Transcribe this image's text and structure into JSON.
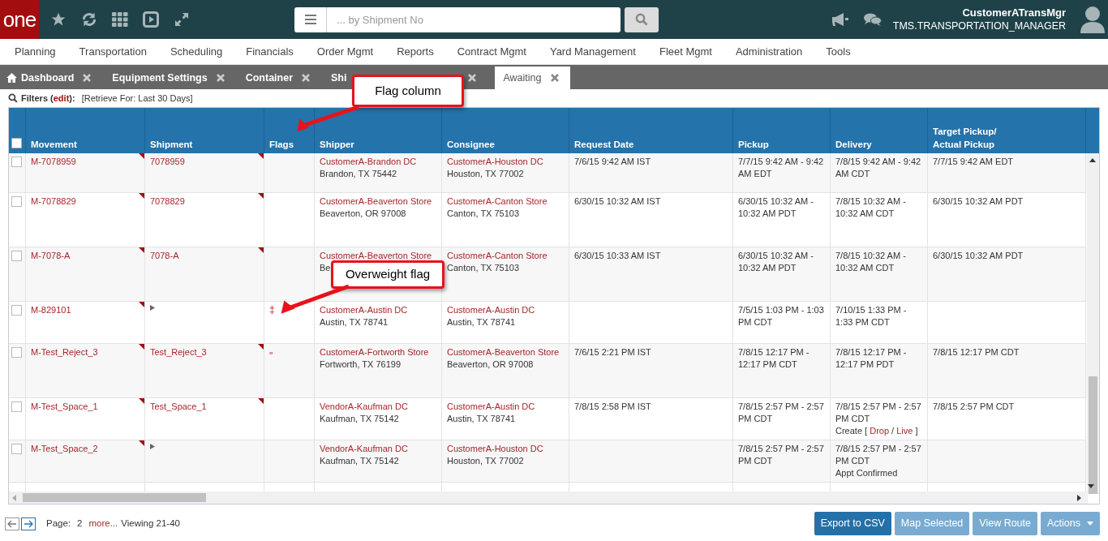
{
  "header": {
    "logo": "one",
    "search": {
      "placeholder": "... by Shipment No"
    },
    "user": {
      "name": "CustomerATransMgr",
      "role": "TMS.TRANSPORTATION_MANAGER"
    }
  },
  "nav": [
    "Planning",
    "Transportation",
    "Scheduling",
    "Financials",
    "Order Mgmt",
    "Reports",
    "Contract Mgmt",
    "Yard Management",
    "Fleet Mgmt",
    "Administration",
    "Tools"
  ],
  "tabs": [
    {
      "label": "Dashboard",
      "home": true,
      "selected": false
    },
    {
      "label": "Equipment Settings",
      "home": false,
      "selected": false
    },
    {
      "label": "Container",
      "home": false,
      "selected": false
    },
    {
      "label": "Shi",
      "home": false,
      "selected": false
    },
    {
      "label": "Awaiting",
      "home": false,
      "selected": true
    }
  ],
  "filters": {
    "label": "Filters (",
    "edit": "edit",
    "suffix": "):",
    "value": "[Retrieve For: Last 30 Days]"
  },
  "table": {
    "select_all_checked": false,
    "columns": [
      "Movement",
      "Shipment",
      "Flags",
      "Shipper",
      "Consignee",
      "Request Date",
      "Pickup",
      "Delivery",
      "Target Pickup/\nActual Pickup"
    ],
    "rows": [
      {
        "checked": false,
        "movement": "M-7078959",
        "shipment": "7078959",
        "flag": null,
        "shipper": "CustomerA-Brandon DC",
        "shipper_address": "Brandon, TX 75442",
        "consignee": "CustomerA-Houston DC",
        "consignee_address": "Houston, TX 77002",
        "request_date": "7/6/15 9:42 AM IST",
        "pickup": "7/7/15 9:42 AM - 9:42 AM EDT",
        "delivery": "7/8/15 9:42 AM - 9:42 AM CDT",
        "target_pickup": "7/7/15 9:42 AM EDT"
      },
      {
        "checked": false,
        "movement": "M-7078829",
        "shipment": "7078829",
        "flag": null,
        "shipper": "CustomerA-Beaverton Store",
        "shipper_address": "Beaverton, OR 97008",
        "consignee": "CustomerA-Canton Store",
        "consignee_address": "Canton, TX 75103",
        "request_date": "6/30/15 10:32 AM IST",
        "pickup": "6/30/15 10:32 AM - 10:32 AM PDT",
        "delivery": "7/8/15 10:32 AM - 10:32 AM CDT",
        "target_pickup": "6/30/15 10:32 AM PDT"
      },
      {
        "checked": false,
        "movement": "M-7078-A",
        "shipment": "7078-A",
        "flag": null,
        "shipper": "CustomerA-Beaverton Store",
        "shipper_address": "Be",
        "consignee": "CustomerA-Canton Store",
        "consignee_address": "Canton, TX 75103",
        "request_date": "6/30/15 10:33 AM IST",
        "pickup": "6/30/15 10:32 AM - 10:32 AM PDT",
        "delivery": "7/8/15 10:32 AM - 10:32 AM CDT",
        "target_pickup": "6/30/15 10:32 AM PDT"
      },
      {
        "checked": false,
        "movement": "M-829101",
        "shipment": null,
        "flag": "‡",
        "shipper": "CustomerA-Austin DC",
        "shipper_address": "Austin, TX 78741",
        "consignee": "CustomerA-Austin DC",
        "consignee_address": "Austin, TX 78741",
        "request_date": null,
        "pickup": "7/5/15 1:03 PM - 1:03 PM CDT",
        "delivery": "7/10/15 1:33 PM - 1:33 PM CDT",
        "target_pickup": null
      },
      {
        "checked": false,
        "movement": "M-Test_Reject_3",
        "shipment": "Test_Reject_3",
        "flag": "¤",
        "shipper": "CustomerA-Fortworth Store",
        "shipper_address": "Fortworth, TX 76199",
        "consignee": "CustomerA-Beaverton Store",
        "consignee_address": "Beaverton, OR 97008",
        "request_date": "7/6/15 2:21 PM IST",
        "pickup": "7/8/15 12:17 PM - 12:17 PM CDT",
        "delivery": "7/8/15 12:17 PM - 12:17 PM PDT",
        "target_pickup": "7/8/15 12:17 PM CDT"
      },
      {
        "checked": false,
        "movement": "M-Test_Space_1",
        "shipment": "Test_Space_1",
        "flag": null,
        "shipper": "VendorA-Kaufman DC",
        "shipper_address": "Kaufman, TX 75142",
        "consignee": "CustomerA-Austin DC",
        "consignee_address": "Austin, TX 78741",
        "request_date": "7/8/15 2:58 PM IST",
        "pickup": "7/8/15 2:57 PM - 2:57 PM CDT",
        "delivery": "7/8/15 2:57 PM - 2:57 PM CDT",
        "delivery_note": [
          {
            "text": "Create [",
            "link": false
          },
          {
            "text": "Drop",
            "link": true
          },
          {
            "text": "/",
            "link": false
          },
          {
            "text": "Live",
            "link": true
          },
          {
            "text": "]",
            "link": false
          }
        ],
        "target_pickup": "7/8/15 2:57 PM CDT"
      },
      {
        "checked": false,
        "movement": "M-Test_Space_2",
        "shipment": null,
        "flag": null,
        "shipper": "VendorA-Kaufman DC",
        "shipper_address": "Kaufman, TX 75142",
        "consignee": "CustomerA-Houston DC",
        "consignee_address": "Houston, TX 77002",
        "request_date": null,
        "pickup": "7/8/15 2:57 PM - 2:57 PM CDT",
        "delivery": "7/8/15 2:57 PM - 2:57 PM CDT",
        "delivery_note": [
          {
            "text": "Appt Confirmed",
            "link": false
          }
        ],
        "target_pickup": null
      }
    ]
  },
  "pager": {
    "label": "Page:",
    "page": "2",
    "more": "more...",
    "viewing": "Viewing 21-40"
  },
  "buttons": [
    {
      "label": "Export to CSV",
      "disabled": false,
      "dropdown": false
    },
    {
      "label": "Map Selected",
      "disabled": true,
      "dropdown": false
    },
    {
      "label": "View Route",
      "disabled": true,
      "dropdown": false
    },
    {
      "label": "Actions",
      "disabled": true,
      "dropdown": true
    }
  ],
  "callouts": [
    {
      "text": "Flag column"
    },
    {
      "text": "Overweight flag"
    }
  ]
}
